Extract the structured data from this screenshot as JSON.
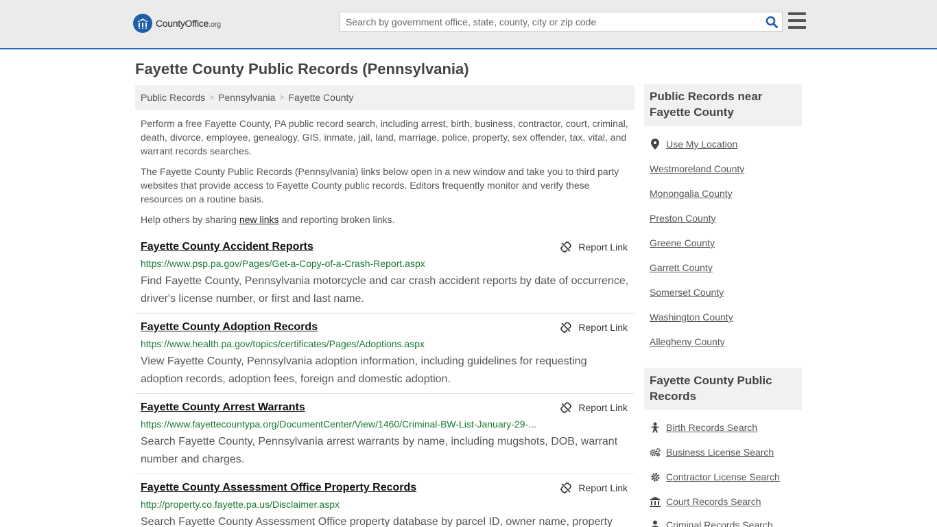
{
  "header": {
    "logo_name": "CountyOffice",
    "logo_tld": ".org",
    "search_placeholder": "Search by government office, state, county, city or zip code"
  },
  "page": {
    "title": "Fayette County Public Records (Pennsylvania)"
  },
  "breadcrumb": [
    "Public Records",
    "Pennsylvania",
    "Fayette County"
  ],
  "intro": {
    "p1": "Perform a free Fayette County, PA public record search, including arrest, birth, business, contractor, court, criminal, death, divorce, employee, genealogy, GIS, inmate, jail, land, marriage, police, property, sex offender, tax, vital, and warrant records searches.",
    "p2": "The Fayette County Public Records (Pennsylvania) links below open in a new window and take you to third party websites that provide access to Fayette County public records. Editors frequently monitor and verify these resources on a routine basis.",
    "p3_before": "Help others by sharing ",
    "p3_link": "new links",
    "p3_after": " and reporting broken links."
  },
  "report_label": "Report Link",
  "records": [
    {
      "title": "Fayette County Accident Reports",
      "url": "https://www.psp.pa.gov/Pages/Get-a-Copy-of-a-Crash-Report.aspx",
      "desc": "Find Fayette County, Pennsylvania motorcycle and car crash accident reports by date of occurrence, driver's license number, or first and last name."
    },
    {
      "title": "Fayette County Adoption Records",
      "url": "https://www.health.pa.gov/topics/certificates/Pages/Adoptions.aspx",
      "desc": "View Fayette County, Pennsylvania adoption information, including guidelines for requesting adoption records, adoption fees, foreign and domestic adoption."
    },
    {
      "title": "Fayette County Arrest Warrants",
      "url": "https://www.fayettecountypa.org/DocumentCenter/View/1460/Criminal-BW-List-January-29-...",
      "desc": "Search Fayette County, Pennsylvania arrest warrants by name, including mugshots, DOB, warrant number and charges."
    },
    {
      "title": "Fayette County Assessment Office Property Records",
      "url": "http://property.co.fayette.pa.us/Disclaimer.aspx",
      "desc": "Search Fayette County Assessment Office property database by parcel ID, owner name, property"
    }
  ],
  "sidebar": {
    "nearby_heading": "Public Records near Fayette County",
    "use_location": "Use My Location",
    "nearby": [
      "Westmoreland County",
      "Monongalia County",
      "Preston County",
      "Greene County",
      "Garrett County",
      "Somerset County",
      "Washington County",
      "Allegheny County"
    ],
    "records_heading": "Fayette County Public Records",
    "record_links": [
      {
        "label": "Birth Records Search",
        "icon": "baby-icon"
      },
      {
        "label": "Business License Search",
        "icon": "gears-icon"
      },
      {
        "label": "Contractor License Search",
        "icon": "gear-icon"
      },
      {
        "label": "Court Records Search",
        "icon": "courthouse-icon"
      },
      {
        "label": "Criminal Records Search",
        "icon": "person-icon"
      }
    ]
  },
  "colors": {
    "accent": "#2b6cb0",
    "url_green": "#1a7a30",
    "search_icon": "#1f5fa8"
  }
}
